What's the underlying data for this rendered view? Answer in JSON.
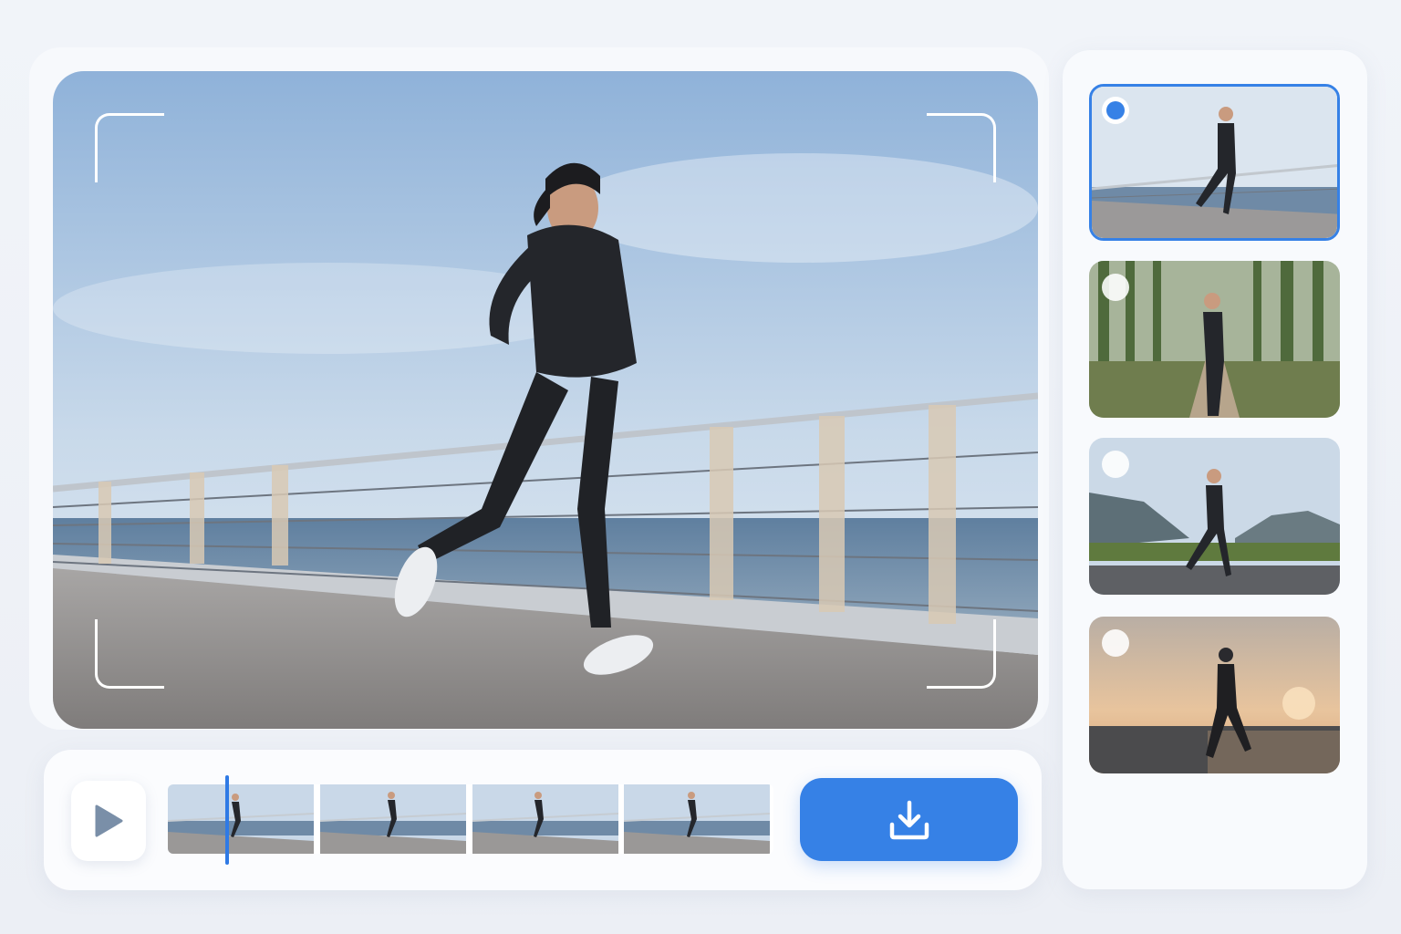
{
  "app": {
    "accent_color": "#3681e6"
  },
  "preview": {
    "scene": "seaside-promenade",
    "overlay": "camera-frame-corners"
  },
  "controls": {
    "play_icon": "play-icon",
    "timeline_frames": [
      "seaside-frame-1",
      "seaside-frame-2",
      "seaside-frame-3",
      "seaside-frame-4"
    ],
    "playhead_progress": 0.1,
    "download_icon": "download-icon"
  },
  "variants": [
    {
      "scene": "seaside-promenade",
      "selected": true
    },
    {
      "scene": "forest-trail",
      "selected": false
    },
    {
      "scene": "mountain-road",
      "selected": false
    },
    {
      "scene": "sunset-shore",
      "selected": false
    }
  ]
}
